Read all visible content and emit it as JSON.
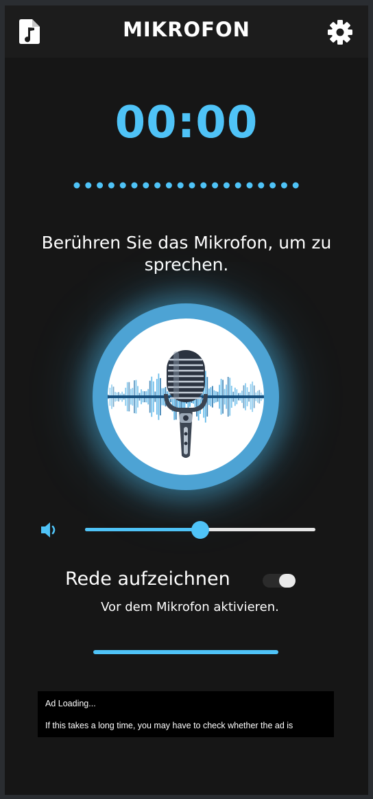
{
  "header": {
    "title": "MIKROFON",
    "left_icon": "music-file-icon",
    "right_icon": "gear-icon"
  },
  "timer": {
    "value": "00:00"
  },
  "instruction": "Berühren Sie das Mikrofon, um zu sprechen.",
  "microphone": {
    "icon": "microphone-icon"
  },
  "volume": {
    "icon": "speaker-icon",
    "level": 0.5
  },
  "record": {
    "label": "Rede aufzeichnen",
    "enabled": false,
    "hint": "Vor dem Mikrofon aktivieren."
  },
  "ad": {
    "line1": "Ad Loading...",
    "line2": "If this takes a long time, you may have to check whether the ad is"
  },
  "colors": {
    "accent": "#4fc3f7",
    "background": "#161616",
    "header": "#1c1c1c"
  }
}
